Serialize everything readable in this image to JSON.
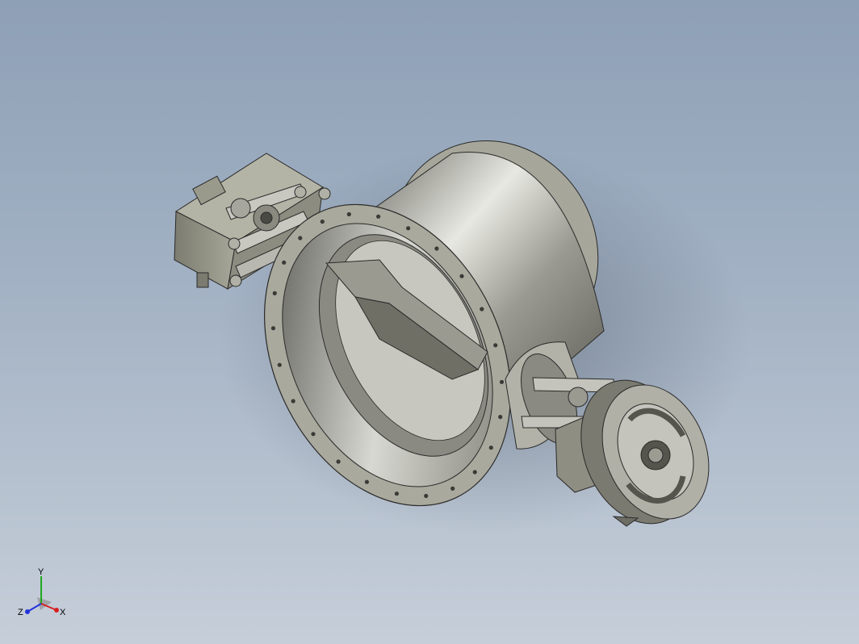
{
  "viewport": {
    "background_top": "#8ea0b6",
    "background_bottom": "#c6ced9"
  },
  "model": {
    "part_color": "#9c9c90",
    "shaded_color": "#b9b9b0",
    "edge_color": "#2a2a2a"
  },
  "triad": {
    "x_label": "X",
    "y_label": "Y",
    "z_label": "Z",
    "x_color": "#d62020",
    "y_color": "#1fa81f",
    "z_color": "#2233dd"
  }
}
